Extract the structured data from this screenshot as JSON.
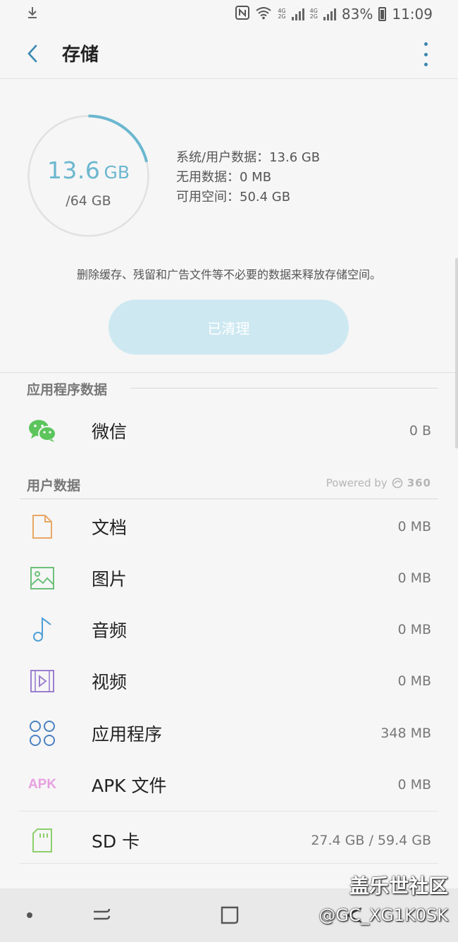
{
  "status_bar": {
    "battery": "83%",
    "time": "11:09",
    "network_a": [
      "4G",
      "2G"
    ],
    "network_b": [
      "4G",
      "2G"
    ],
    "icons": [
      "download-icon",
      "nfc-icon",
      "wifi-icon",
      "signal-icon",
      "battery-icon"
    ]
  },
  "header": {
    "title": "存储",
    "back_icon": "back-arrow-icon",
    "menu_icon": "more-vert-icon"
  },
  "storage": {
    "used_value": "13.6",
    "used_unit": "GB",
    "total": "/64 GB",
    "used_fraction": 0.2125,
    "ring_color": "#6bb7cf",
    "stats": [
      "系统/用户数据：13.6 GB",
      "无用数据：0 MB",
      "可用空间：50.4 GB"
    ],
    "hint": "删除缓存、残留和广告文件等不必要的数据来释放存储空间。",
    "clean_button": "已清理"
  },
  "app_data": {
    "title": "应用程序数据",
    "items": [
      {
        "label": "微信",
        "value": "0 B",
        "icon": "wechat-icon"
      }
    ]
  },
  "user_data": {
    "title": "用户数据",
    "powered_by": "Powered by",
    "brand": "360",
    "items": [
      {
        "label": "文档",
        "value": "0 MB",
        "icon": "document-icon"
      },
      {
        "label": "图片",
        "value": "0 MB",
        "icon": "image-icon"
      },
      {
        "label": "音频",
        "value": "0 MB",
        "icon": "music-icon"
      },
      {
        "label": "视频",
        "value": "0 MB",
        "icon": "video-icon"
      },
      {
        "label": "应用程序",
        "value": "348 MB",
        "icon": "apps-icon"
      },
      {
        "label": "APK 文件",
        "value": "0 MB",
        "icon": "apk-icon",
        "icon_text": "APK"
      },
      {
        "label": "SD 卡",
        "value": "27.4 GB / 59.4 GB",
        "icon": "sd-card-icon"
      }
    ]
  },
  "navigation": {
    "items": [
      "dot-icon",
      "recents-icon",
      "home-icon",
      "back-icon"
    ]
  },
  "watermark": {
    "title": "盖乐世社区",
    "handle": "@GC_XG1K0SK"
  },
  "colors": {
    "accent": "#6bb7cf",
    "button_bg": "#cde8f1",
    "wechat": "#5cc55c",
    "document": "#e8a866",
    "image": "#6cc07a",
    "music": "#4f9fd6",
    "video": "#9b7fd0",
    "apps": "#4b82c2",
    "apk": "#e8a0e0",
    "sd": "#8ccf6a"
  }
}
